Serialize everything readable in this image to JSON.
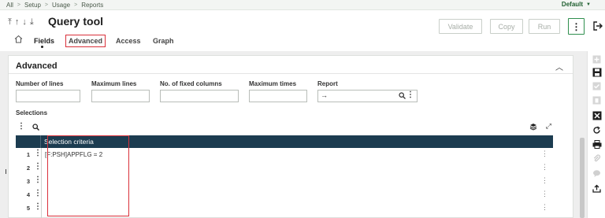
{
  "breadcrumb": [
    "All",
    "Setup",
    "Usage",
    "Reports"
  ],
  "profile": {
    "label": "Default"
  },
  "header": {
    "title": "Query tool",
    "buttons": {
      "validate": "Validate",
      "copy": "Copy",
      "run": "Run"
    }
  },
  "tabs": [
    {
      "label": "Fields",
      "active": true
    },
    {
      "label": "Advanced",
      "highlighted": true
    },
    {
      "label": "Access"
    },
    {
      "label": "Graph"
    }
  ],
  "section": {
    "title": "Advanced",
    "fields": [
      {
        "label": "Number of lines",
        "value": ""
      },
      {
        "label": "Maximum lines",
        "value": ""
      },
      {
        "label": "No. of fixed columns",
        "value": ""
      },
      {
        "label": "Maximum times",
        "value": ""
      },
      {
        "label": "Report",
        "value": ""
      }
    ],
    "selections": {
      "label": "Selections",
      "column": "Selection criteria",
      "rows": [
        {
          "num": "1",
          "value": "[F:PSH]APPFLG = 2"
        },
        {
          "num": "2",
          "value": ""
        },
        {
          "num": "3",
          "value": ""
        },
        {
          "num": "4",
          "value": ""
        },
        {
          "num": "5",
          "value": ""
        }
      ]
    }
  },
  "icons": {
    "arrows": [
      "first-record-icon",
      "previous-record-icon",
      "next-record-icon",
      "last-record-icon"
    ],
    "rail": [
      "add-icon",
      "save-icon",
      "check-icon",
      "delete-icon",
      "close-icon",
      "refresh-icon",
      "print-icon",
      "attach-icon",
      "comment-icon",
      "upload-icon"
    ]
  },
  "colors": {
    "accent": "#2f8f4e",
    "grid_header": "#1c3c50",
    "highlight": "#d9303a"
  }
}
